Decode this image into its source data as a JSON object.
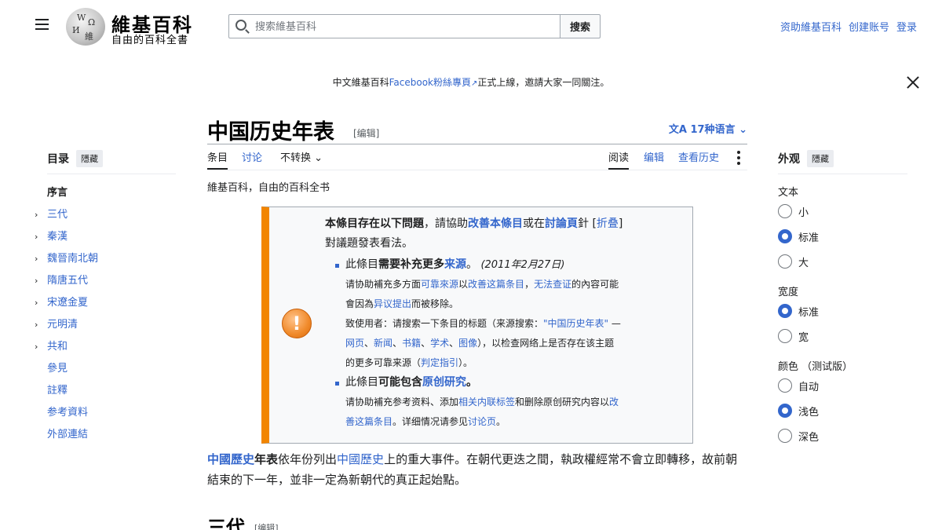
{
  "header": {
    "wordmark": "維基百科",
    "tagline": "自由的百科全書",
    "search_placeholder": "搜索維基百科",
    "search_button": "搜索",
    "links": [
      "资助維基百科",
      "创建账号",
      "登录"
    ]
  },
  "notice": {
    "prefix": "中文維基百科",
    "link": "Facebook粉絲專頁",
    "suffix": "正式上線，邀請大家一同關注。"
  },
  "toc": {
    "title": "目录",
    "hide": "隱藏",
    "items": [
      {
        "label": "序言",
        "active": true,
        "expandable": false
      },
      {
        "label": "三代",
        "active": false,
        "expandable": true
      },
      {
        "label": "秦漢",
        "active": false,
        "expandable": true
      },
      {
        "label": "魏晉南北朝",
        "active": false,
        "expandable": true
      },
      {
        "label": "隋唐五代",
        "active": false,
        "expandable": true
      },
      {
        "label": "宋遼金夏",
        "active": false,
        "expandable": true
      },
      {
        "label": "元明清",
        "active": false,
        "expandable": true
      },
      {
        "label": "共和",
        "active": false,
        "expandable": true
      },
      {
        "label": "參見",
        "active": false,
        "expandable": false
      },
      {
        "label": "註釋",
        "active": false,
        "expandable": false
      },
      {
        "label": "参考資料",
        "active": false,
        "expandable": false
      },
      {
        "label": "外部連結",
        "active": false,
        "expandable": false
      }
    ]
  },
  "appearance": {
    "title": "外观",
    "hide": "隱藏",
    "text_label": "文本",
    "text_options": [
      "小",
      "标准",
      "大"
    ],
    "text_selected": 1,
    "width_label": "宽度",
    "width_options": [
      "标准",
      "宽"
    ],
    "width_selected": 0,
    "color_label": "颜色 （测试版）",
    "color_options": [
      "自动",
      "浅色",
      "深色"
    ],
    "color_selected": 1
  },
  "article": {
    "title": "中国历史年表",
    "edit": "[编辑]",
    "languages": "17种语言",
    "tabs_left": [
      "条目",
      "讨论",
      "不转换"
    ],
    "tabs_right": [
      "阅读",
      "编辑",
      "查看历史"
    ],
    "site_sub": "維基百科，自由的百科全书",
    "ambox": {
      "icon": "!",
      "header_bold": "本條目存在以下問題",
      "header_mid": "，請協助",
      "header_link1": "改善本條目",
      "header_or": "或在",
      "header_link2": "討論頁",
      "header_end": "針",
      "fold": "折叠",
      "header_tail": "對議題發表看法。",
      "issue1_pre": "此條目",
      "issue1_bold": "需要补充更多",
      "issue1_link": "来源",
      "issue1_end": "。",
      "issue1_date": "(2011年2月27日)",
      "issue1_line1_pre": "请协助補充多方面",
      "issue1_line1_l1": "可靠來源",
      "issue1_line1_mid": "以",
      "issue1_line1_l2": "改善这篇条目",
      "issue1_line1_sep": "，",
      "issue1_line1_l3": "无法查证",
      "issue1_line1_end": "的內容可能",
      "issue1_line2_pre": "會因為",
      "issue1_line2_l": "异议提出",
      "issue1_line2_end": "而被移除。",
      "issue1_line3_pre": "致使用者：请搜索一下条目的标题（来源搜索：",
      "issue1_line3_q": "\"中国历史年表\"",
      "issue1_line3_end": " —",
      "issue1_sources": [
        "网页",
        "新闻",
        "书籍",
        "学术",
        "图像"
      ],
      "issue1_line4_end": "），以检查网络上是否存在该主题",
      "issue1_line5_pre": "的更多可靠来源（",
      "issue1_line5_l": "判定指引",
      "issue1_line5_end": "）。",
      "issue2_pre": "此條目",
      "issue2_bold": "可能包含",
      "issue2_link": "原创研究",
      "issue2_end": "。",
      "issue2_line1_pre": "请协助補充参考资料、添加",
      "issue2_line1_l": "相关内联标签",
      "issue2_line1_mid": "和删除原创研究内容以",
      "issue2_line1_l2a": "改",
      "issue2_line2_l2b": "善这篇条目",
      "issue2_line2_mid": "。详细情况请参见",
      "issue2_line2_l3": "讨论页",
      "issue2_line2_end": "。"
    },
    "para_link1": "中國歷史",
    "para_bold": "年表",
    "para_mid": "依年份列出",
    "para_link2": "中國歷史",
    "para_rest": "上的重大事件。在朝代更迭之間，執政權經常不會立即轉移，故前朝結束的下一年，並非一定為新朝代的真正起始點。",
    "section_title": "三代",
    "section_edit": "[编辑]"
  }
}
